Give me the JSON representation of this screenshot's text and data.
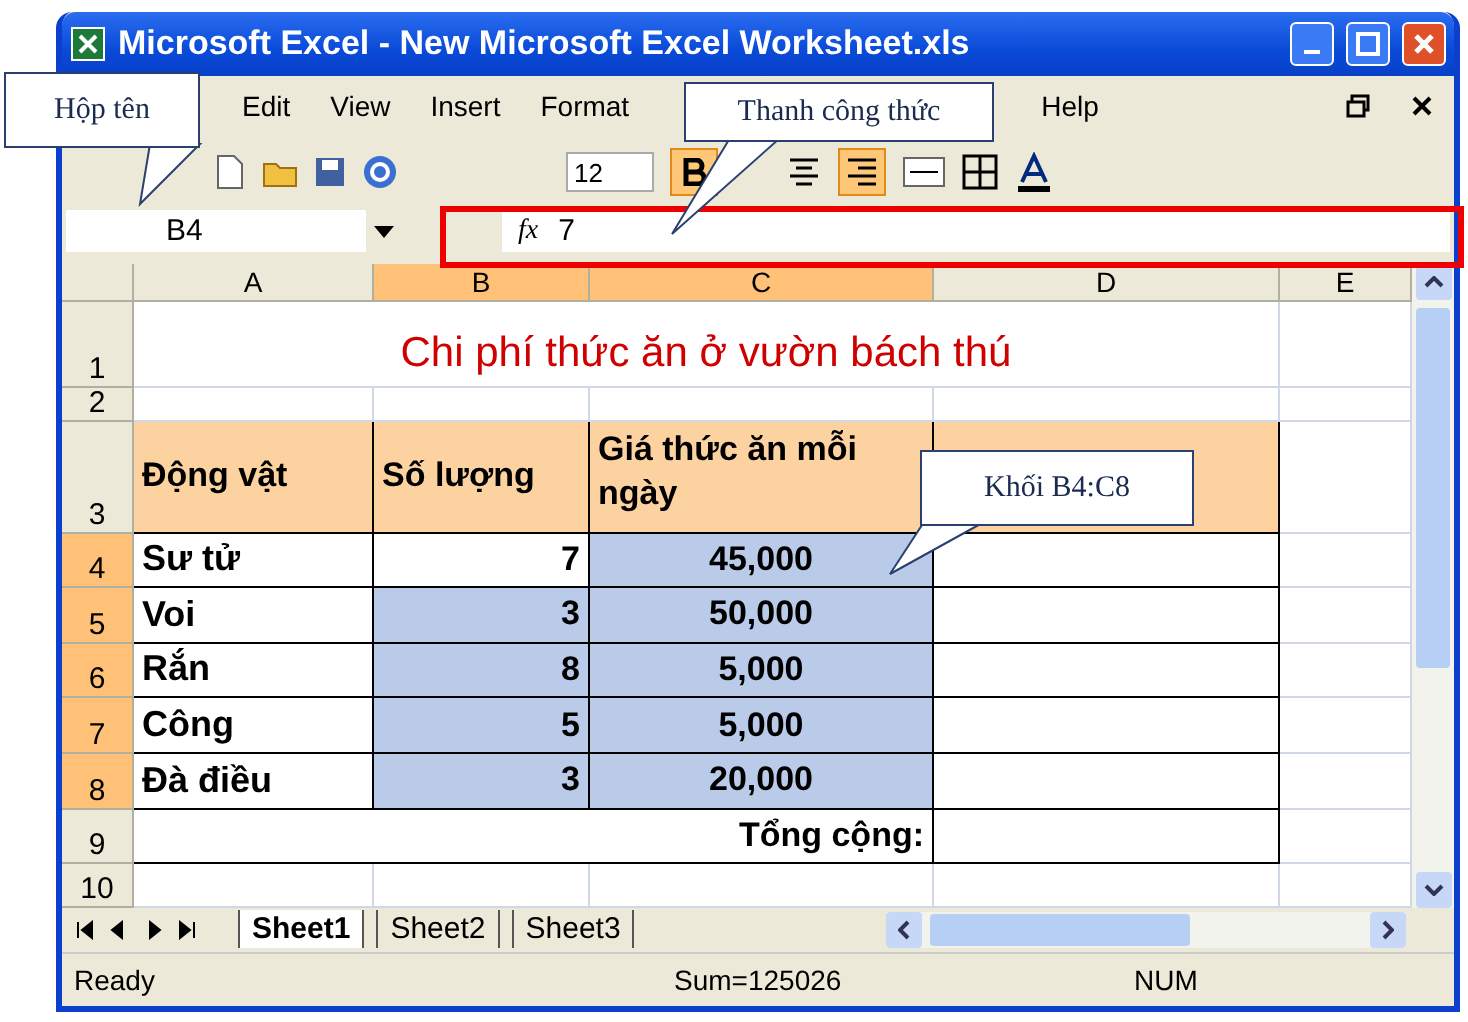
{
  "window": {
    "title": "Microsoft Excel - New Microsoft Excel Worksheet.xls"
  },
  "menu": [
    "Edit",
    "View",
    "Insert",
    "Format",
    "Help"
  ],
  "toolbar": {
    "font_size": "12"
  },
  "formula_bar": {
    "name_box": "B4",
    "function_label": "fx",
    "formula": "7"
  },
  "columns": [
    {
      "label": "A",
      "selected": false
    },
    {
      "label": "B",
      "selected": true
    },
    {
      "label": "C",
      "selected": true
    },
    {
      "label": "D",
      "selected": false
    },
    {
      "label": "E",
      "selected": false
    }
  ],
  "rows": [
    {
      "header": "1",
      "selected": false,
      "kind": "title",
      "cells": [
        {
          "text": "Chi phí thức ăn ở vườn bách thú"
        }
      ]
    },
    {
      "header": "2",
      "selected": false,
      "kind": "blank",
      "cells": []
    },
    {
      "header": "3",
      "selected": false,
      "kind": "heading",
      "cells": [
        {
          "text": "Động vật"
        },
        {
          "text": "Số lượng"
        },
        {
          "text": "Giá thức ăn mỗi ngày"
        }
      ]
    },
    {
      "header": "4",
      "selected": true,
      "kind": "data",
      "cells": [
        {
          "text": "Sư tử",
          "selected": false
        },
        {
          "text": "7",
          "selected": false
        },
        {
          "text": "45,000",
          "selected": true
        }
      ]
    },
    {
      "header": "5",
      "selected": true,
      "kind": "data",
      "cells": [
        {
          "text": "Voi",
          "selected": false
        },
        {
          "text": "3",
          "selected": true
        },
        {
          "text": "50,000",
          "selected": true
        }
      ]
    },
    {
      "header": "6",
      "selected": true,
      "kind": "data",
      "cells": [
        {
          "text": "Rắn",
          "selected": false
        },
        {
          "text": "8",
          "selected": true
        },
        {
          "text": "5,000",
          "selected": true
        }
      ]
    },
    {
      "header": "7",
      "selected": true,
      "kind": "data",
      "cells": [
        {
          "text": "Công",
          "selected": false
        },
        {
          "text": "5",
          "selected": true
        },
        {
          "text": "5,000",
          "selected": true
        }
      ]
    },
    {
      "header": "8",
      "selected": true,
      "kind": "data",
      "cells": [
        {
          "text": "Đà điều",
          "selected": false
        },
        {
          "text": "3",
          "selected": true
        },
        {
          "text": "20,000",
          "selected": true
        }
      ]
    },
    {
      "header": "9",
      "selected": false,
      "kind": "total",
      "cells": [
        {
          "text": "Tổng cộng:"
        }
      ]
    },
    {
      "header": "10",
      "selected": false,
      "kind": "blank",
      "cells": []
    }
  ],
  "sheet_tabs": [
    {
      "label": "Sheet1",
      "selected": true
    },
    {
      "label": "Sheet2",
      "selected": false
    },
    {
      "label": "Sheet3",
      "selected": false
    }
  ],
  "status_bar": {
    "state": "Ready",
    "sum": "Sum=125026",
    "num": "NUM"
  },
  "callouts": [
    {
      "text": "Hộp tên"
    },
    {
      "text": "Thanh công thức"
    },
    {
      "text": "Khối B4:C8"
    }
  ]
}
